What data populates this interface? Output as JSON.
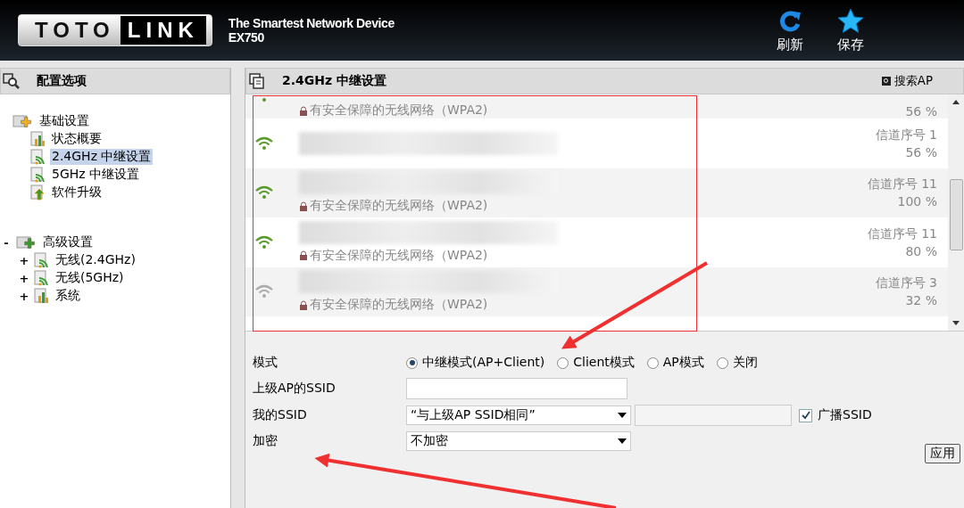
{
  "header": {
    "logo_left": "TOTO",
    "logo_right": "LINK",
    "tagline": "The Smartest Network Device",
    "model": "EX750",
    "actions": [
      {
        "kind": "refresh",
        "label": "刷新"
      },
      {
        "kind": "save",
        "label": "保存"
      }
    ]
  },
  "sidebar": {
    "title": "配置选项",
    "tree": [
      {
        "label": "基础设置",
        "kind": "group-basic",
        "selected": false,
        "children": [
          {
            "label": "状态概要",
            "kind": "chart",
            "selected": false
          },
          {
            "label": "2.4GHz 中继设置",
            "kind": "wifi",
            "selected": true
          },
          {
            "label": "5GHz 中继设置",
            "kind": "wifi",
            "selected": false
          },
          {
            "label": "软件升级",
            "kind": "upgrade",
            "selected": false
          }
        ]
      },
      {
        "label": "高级设置",
        "kind": "group-advanced",
        "toggle": "-",
        "selected": false,
        "children": [
          {
            "label": "无线(2.4GHz)",
            "kind": "wifi",
            "toggle": "+",
            "selected": false
          },
          {
            "label": "无线(5GHz)",
            "kind": "wifi",
            "toggle": "+",
            "selected": false
          },
          {
            "label": "系统",
            "kind": "chart",
            "toggle": "+",
            "selected": false
          }
        ]
      }
    ]
  },
  "main": {
    "title": "2.4GHz 中继设置",
    "search_button": "搜索AP",
    "networks": [
      {
        "kind": "strong",
        "security": "有安全保障的无线网络（WPA2)",
        "signal": "56 %"
      },
      {
        "kind": "strong",
        "channel": "信道序号  1",
        "signal": "56 %"
      },
      {
        "kind": "strong",
        "security": "有安全保障的无线网络（WPA2)",
        "channel": "信道序号  11",
        "signal": "100 %"
      },
      {
        "kind": "strong",
        "security": "有安全保障的无线网络（WPA2)",
        "channel": "信道序号  11",
        "signal": "80 %"
      },
      {
        "kind": "weak",
        "security": "有安全保障的无线网络（WPA2)",
        "channel": "信道序号  3",
        "signal": "32 %"
      }
    ],
    "form": {
      "mode_label": "模式",
      "modes": [
        {
          "label": "中继模式(AP+Client)",
          "selected": true
        },
        {
          "label": "Client模式",
          "selected": false
        },
        {
          "label": "AP模式",
          "selected": false
        },
        {
          "label": "关闭",
          "selected": false
        }
      ],
      "upstream_label": "上级AP的SSID",
      "my_ssid_label": "我的SSID",
      "my_ssid_value": "“与上级AP SSID相同”",
      "broadcast_label": "广播SSID",
      "broadcast_checked": true,
      "encryption_label": "加密",
      "encryption_value": "不加密",
      "apply": "应用"
    }
  }
}
